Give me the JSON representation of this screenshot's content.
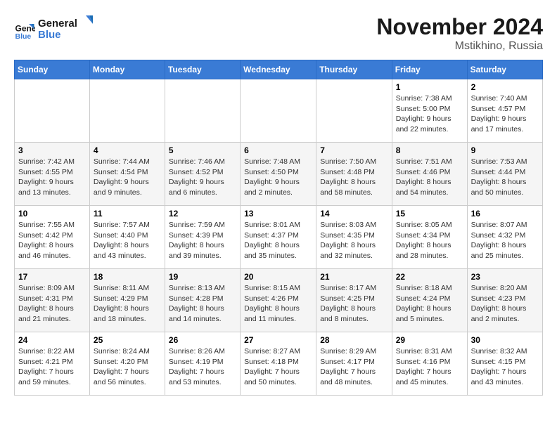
{
  "logo": {
    "line1": "General",
    "line2": "Blue"
  },
  "title": "November 2024",
  "location": "Mstikhino, Russia",
  "weekdays": [
    "Sunday",
    "Monday",
    "Tuesday",
    "Wednesday",
    "Thursday",
    "Friday",
    "Saturday"
  ],
  "weeks": [
    [
      {
        "day": "",
        "info": ""
      },
      {
        "day": "",
        "info": ""
      },
      {
        "day": "",
        "info": ""
      },
      {
        "day": "",
        "info": ""
      },
      {
        "day": "",
        "info": ""
      },
      {
        "day": "1",
        "info": "Sunrise: 7:38 AM\nSunset: 5:00 PM\nDaylight: 9 hours and 22 minutes."
      },
      {
        "day": "2",
        "info": "Sunrise: 7:40 AM\nSunset: 4:57 PM\nDaylight: 9 hours and 17 minutes."
      }
    ],
    [
      {
        "day": "3",
        "info": "Sunrise: 7:42 AM\nSunset: 4:55 PM\nDaylight: 9 hours and 13 minutes."
      },
      {
        "day": "4",
        "info": "Sunrise: 7:44 AM\nSunset: 4:54 PM\nDaylight: 9 hours and 9 minutes."
      },
      {
        "day": "5",
        "info": "Sunrise: 7:46 AM\nSunset: 4:52 PM\nDaylight: 9 hours and 6 minutes."
      },
      {
        "day": "6",
        "info": "Sunrise: 7:48 AM\nSunset: 4:50 PM\nDaylight: 9 hours and 2 minutes."
      },
      {
        "day": "7",
        "info": "Sunrise: 7:50 AM\nSunset: 4:48 PM\nDaylight: 8 hours and 58 minutes."
      },
      {
        "day": "8",
        "info": "Sunrise: 7:51 AM\nSunset: 4:46 PM\nDaylight: 8 hours and 54 minutes."
      },
      {
        "day": "9",
        "info": "Sunrise: 7:53 AM\nSunset: 4:44 PM\nDaylight: 8 hours and 50 minutes."
      }
    ],
    [
      {
        "day": "10",
        "info": "Sunrise: 7:55 AM\nSunset: 4:42 PM\nDaylight: 8 hours and 46 minutes."
      },
      {
        "day": "11",
        "info": "Sunrise: 7:57 AM\nSunset: 4:40 PM\nDaylight: 8 hours and 43 minutes."
      },
      {
        "day": "12",
        "info": "Sunrise: 7:59 AM\nSunset: 4:39 PM\nDaylight: 8 hours and 39 minutes."
      },
      {
        "day": "13",
        "info": "Sunrise: 8:01 AM\nSunset: 4:37 PM\nDaylight: 8 hours and 35 minutes."
      },
      {
        "day": "14",
        "info": "Sunrise: 8:03 AM\nSunset: 4:35 PM\nDaylight: 8 hours and 32 minutes."
      },
      {
        "day": "15",
        "info": "Sunrise: 8:05 AM\nSunset: 4:34 PM\nDaylight: 8 hours and 28 minutes."
      },
      {
        "day": "16",
        "info": "Sunrise: 8:07 AM\nSunset: 4:32 PM\nDaylight: 8 hours and 25 minutes."
      }
    ],
    [
      {
        "day": "17",
        "info": "Sunrise: 8:09 AM\nSunset: 4:31 PM\nDaylight: 8 hours and 21 minutes."
      },
      {
        "day": "18",
        "info": "Sunrise: 8:11 AM\nSunset: 4:29 PM\nDaylight: 8 hours and 18 minutes."
      },
      {
        "day": "19",
        "info": "Sunrise: 8:13 AM\nSunset: 4:28 PM\nDaylight: 8 hours and 14 minutes."
      },
      {
        "day": "20",
        "info": "Sunrise: 8:15 AM\nSunset: 4:26 PM\nDaylight: 8 hours and 11 minutes."
      },
      {
        "day": "21",
        "info": "Sunrise: 8:17 AM\nSunset: 4:25 PM\nDaylight: 8 hours and 8 minutes."
      },
      {
        "day": "22",
        "info": "Sunrise: 8:18 AM\nSunset: 4:24 PM\nDaylight: 8 hours and 5 minutes."
      },
      {
        "day": "23",
        "info": "Sunrise: 8:20 AM\nSunset: 4:23 PM\nDaylight: 8 hours and 2 minutes."
      }
    ],
    [
      {
        "day": "24",
        "info": "Sunrise: 8:22 AM\nSunset: 4:21 PM\nDaylight: 7 hours and 59 minutes."
      },
      {
        "day": "25",
        "info": "Sunrise: 8:24 AM\nSunset: 4:20 PM\nDaylight: 7 hours and 56 minutes."
      },
      {
        "day": "26",
        "info": "Sunrise: 8:26 AM\nSunset: 4:19 PM\nDaylight: 7 hours and 53 minutes."
      },
      {
        "day": "27",
        "info": "Sunrise: 8:27 AM\nSunset: 4:18 PM\nDaylight: 7 hours and 50 minutes."
      },
      {
        "day": "28",
        "info": "Sunrise: 8:29 AM\nSunset: 4:17 PM\nDaylight: 7 hours and 48 minutes."
      },
      {
        "day": "29",
        "info": "Sunrise: 8:31 AM\nSunset: 4:16 PM\nDaylight: 7 hours and 45 minutes."
      },
      {
        "day": "30",
        "info": "Sunrise: 8:32 AM\nSunset: 4:15 PM\nDaylight: 7 hours and 43 minutes."
      }
    ]
  ]
}
